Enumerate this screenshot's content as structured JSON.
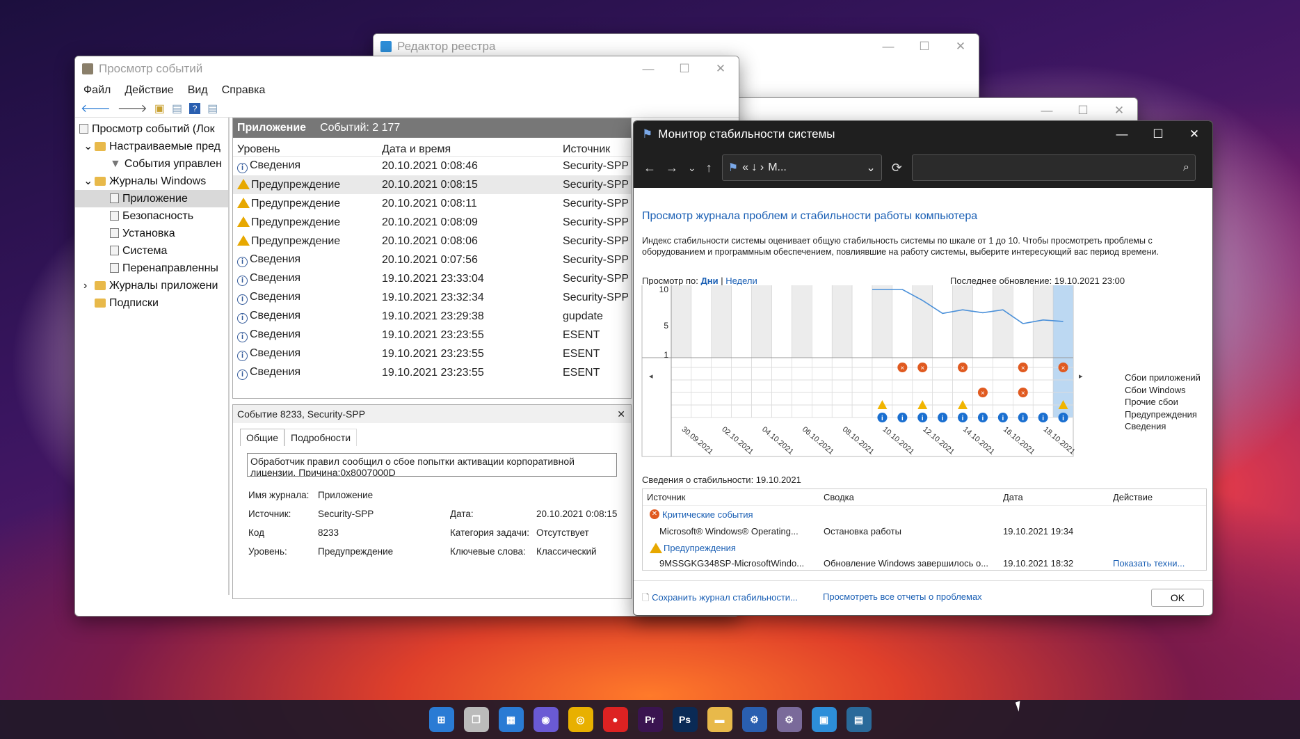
{
  "registry": {
    "title": "Редактор реестра"
  },
  "eventviewer": {
    "title": "Просмотр событий",
    "menu": [
      "Файл",
      "Действие",
      "Вид",
      "Справка"
    ],
    "tree": [
      {
        "label": "Просмотр событий (Лок",
        "indent": 0,
        "type": "root"
      },
      {
        "label": "Настраиваемые пред",
        "indent": 1,
        "type": "folder",
        "exp": "v"
      },
      {
        "label": "События управлен",
        "indent": 2,
        "type": "filter"
      },
      {
        "label": "Журналы Windows",
        "indent": 1,
        "type": "folder",
        "exp": "v"
      },
      {
        "label": "Приложение",
        "indent": 2,
        "type": "log",
        "sel": true
      },
      {
        "label": "Безопасность",
        "indent": 2,
        "type": "log"
      },
      {
        "label": "Установка",
        "indent": 2,
        "type": "log"
      },
      {
        "label": "Система",
        "indent": 2,
        "type": "log"
      },
      {
        "label": "Перенаправленны",
        "indent": 2,
        "type": "log"
      },
      {
        "label": "Журналы приложени",
        "indent": 1,
        "type": "folder",
        "exp": ">"
      },
      {
        "label": "Подписки",
        "indent": 1,
        "type": "sub"
      }
    ],
    "list_header": {
      "name": "Приложение",
      "count": "Событий: 2 177"
    },
    "columns": [
      "Уровень",
      "Дата и время",
      "Источник"
    ],
    "rows": [
      {
        "level": "Сведения",
        "type": "i",
        "date": "20.10.2021 0:08:46",
        "source": "Security-SPP"
      },
      {
        "level": "Предупреждение",
        "type": "w",
        "date": "20.10.2021 0:08:15",
        "source": "Security-SPP",
        "hl": true
      },
      {
        "level": "Предупреждение",
        "type": "w",
        "date": "20.10.2021 0:08:11",
        "source": "Security-SPP"
      },
      {
        "level": "Предупреждение",
        "type": "w",
        "date": "20.10.2021 0:08:09",
        "source": "Security-SPP"
      },
      {
        "level": "Предупреждение",
        "type": "w",
        "date": "20.10.2021 0:08:06",
        "source": "Security-SPP"
      },
      {
        "level": "Сведения",
        "type": "i",
        "date": "20.10.2021 0:07:56",
        "source": "Security-SPP"
      },
      {
        "level": "Сведения",
        "type": "i",
        "date": "19.10.2021 23:33:04",
        "source": "Security-SPP"
      },
      {
        "level": "Сведения",
        "type": "i",
        "date": "19.10.2021 23:32:34",
        "source": "Security-SPP"
      },
      {
        "level": "Сведения",
        "type": "i",
        "date": "19.10.2021 23:29:38",
        "source": "gupdate"
      },
      {
        "level": "Сведения",
        "type": "i",
        "date": "19.10.2021 23:23:55",
        "source": "ESENT"
      },
      {
        "level": "Сведения",
        "type": "i",
        "date": "19.10.2021 23:23:55",
        "source": "ESENT"
      },
      {
        "level": "Сведения",
        "type": "i",
        "date": "19.10.2021 23:23:55",
        "source": "ESENT"
      }
    ],
    "detail": {
      "title": "Событие 8233, Security-SPP",
      "tabs": [
        "Общие",
        "Подробности"
      ],
      "message": "Обработчик правил сообщил о сбое попытки активации корпоративной лицензии. Причина:0x8007000D",
      "log_label": "Имя журнала:",
      "log_value": "Приложение",
      "source_label": "Источник:",
      "source_value": "Security-SPP",
      "date_label": "Дата:",
      "date_value": "20.10.2021 0:08:15",
      "code_label": "Код",
      "code_value": "8233",
      "cat_label": "Категория задачи:",
      "cat_value": "Отсутствует",
      "level_label": "Уровень:",
      "level_value": "Предупреждение",
      "kw_label": "Ключевые слова:",
      "kw_value": "Классический"
    }
  },
  "stability": {
    "title": "Монитор стабильности системы",
    "address": "M...",
    "heading": "Просмотр журнала проблем и стабильности работы компьютера",
    "description": "Индекс стабильности системы оценивает общую стабильность системы по шкале от 1 до 10. Чтобы просмотреть проблемы с оборудованием и программным обеспечением, повлиявшие на работу системы, выберите интересующий вас период времени.",
    "view_by": "Просмотр по:",
    "days": "Дни",
    "weeks": "Недели",
    "last_update": "Последнее обновление: 19.10.2021 23:00",
    "legend": [
      "Сбои приложений",
      "Сбои Windows",
      "Прочие сбои",
      "Предупреждения",
      "Сведения"
    ],
    "details_label": "Сведения о стабильности: 19.10.2021",
    "table_cols": [
      "Источник",
      "Сводка",
      "Дата",
      "Действие"
    ],
    "critical": "Критические события",
    "crit_row": {
      "source": "Microsoft® Windows® Operating...",
      "summary": "Остановка работы",
      "date": "19.10.2021 19:34"
    },
    "warnings": "Предупреждения",
    "warn_row": {
      "source": "9MSSGKG348SP-MicrosoftWindo...",
      "summary": "Обновление Windows завершилось о...",
      "date": "19.10.2021 18:32",
      "action": "Показать техни..."
    },
    "save_link": "Сохранить журнал стабильности...",
    "view_link": "Просмотреть все отчеты о проблемах",
    "ok": "OK"
  },
  "chart_data": {
    "type": "line",
    "title": "",
    "yticks": [
      10,
      5,
      1
    ],
    "ylim": [
      1,
      10
    ],
    "x_labels": [
      "30.09.2021",
      "02.10.2021",
      "04.10.2021",
      "06.10.2021",
      "08.10.2021",
      "10.10.2021",
      "12.10.2021",
      "14.10.2021",
      "16.10.2021",
      "18.10.2021"
    ],
    "days": [
      "30.09",
      "01.10",
      "02.10",
      "03.10",
      "04.10",
      "05.10",
      "06.10",
      "07.10",
      "08.10",
      "09.10",
      "10.10",
      "11.10",
      "12.10",
      "13.10",
      "14.10",
      "15.10",
      "16.10",
      "17.10",
      "18.10",
      "19.10"
    ],
    "index": [
      null,
      null,
      null,
      null,
      null,
      null,
      null,
      null,
      null,
      null,
      10,
      10,
      8.5,
      6.7,
      7.2,
      6.8,
      7.2,
      5.3,
      5.8,
      5.6
    ],
    "app_failures": [
      0,
      0,
      0,
      0,
      0,
      0,
      0,
      0,
      0,
      0,
      0,
      1,
      1,
      0,
      1,
      0,
      0,
      1,
      0,
      1
    ],
    "other_failures": [
      0,
      0,
      0,
      0,
      0,
      0,
      0,
      0,
      0,
      0,
      0,
      0,
      0,
      0,
      0,
      1,
      0,
      1,
      0,
      0
    ],
    "warnings": [
      0,
      0,
      0,
      0,
      0,
      0,
      0,
      0,
      0,
      0,
      1,
      0,
      1,
      0,
      1,
      0,
      0,
      0,
      0,
      1
    ],
    "info": [
      0,
      0,
      0,
      0,
      0,
      0,
      0,
      0,
      0,
      0,
      1,
      1,
      1,
      1,
      1,
      1,
      1,
      1,
      1,
      1
    ],
    "selected_day": "19.10",
    "colors": {
      "line": "#4a90d9",
      "fail": "#e05a20",
      "warn": "#f0b400",
      "info": "#1a6fd0",
      "selected": "#bcd8f2"
    }
  },
  "taskbar": [
    "Windows",
    "Представление задач",
    "Виджеты",
    "Чат",
    "Chrome",
    "OBS",
    "Pr",
    "Ps",
    "Проводник",
    "Инструменты",
    "Службы",
    "Реестр",
    "Монитор"
  ]
}
